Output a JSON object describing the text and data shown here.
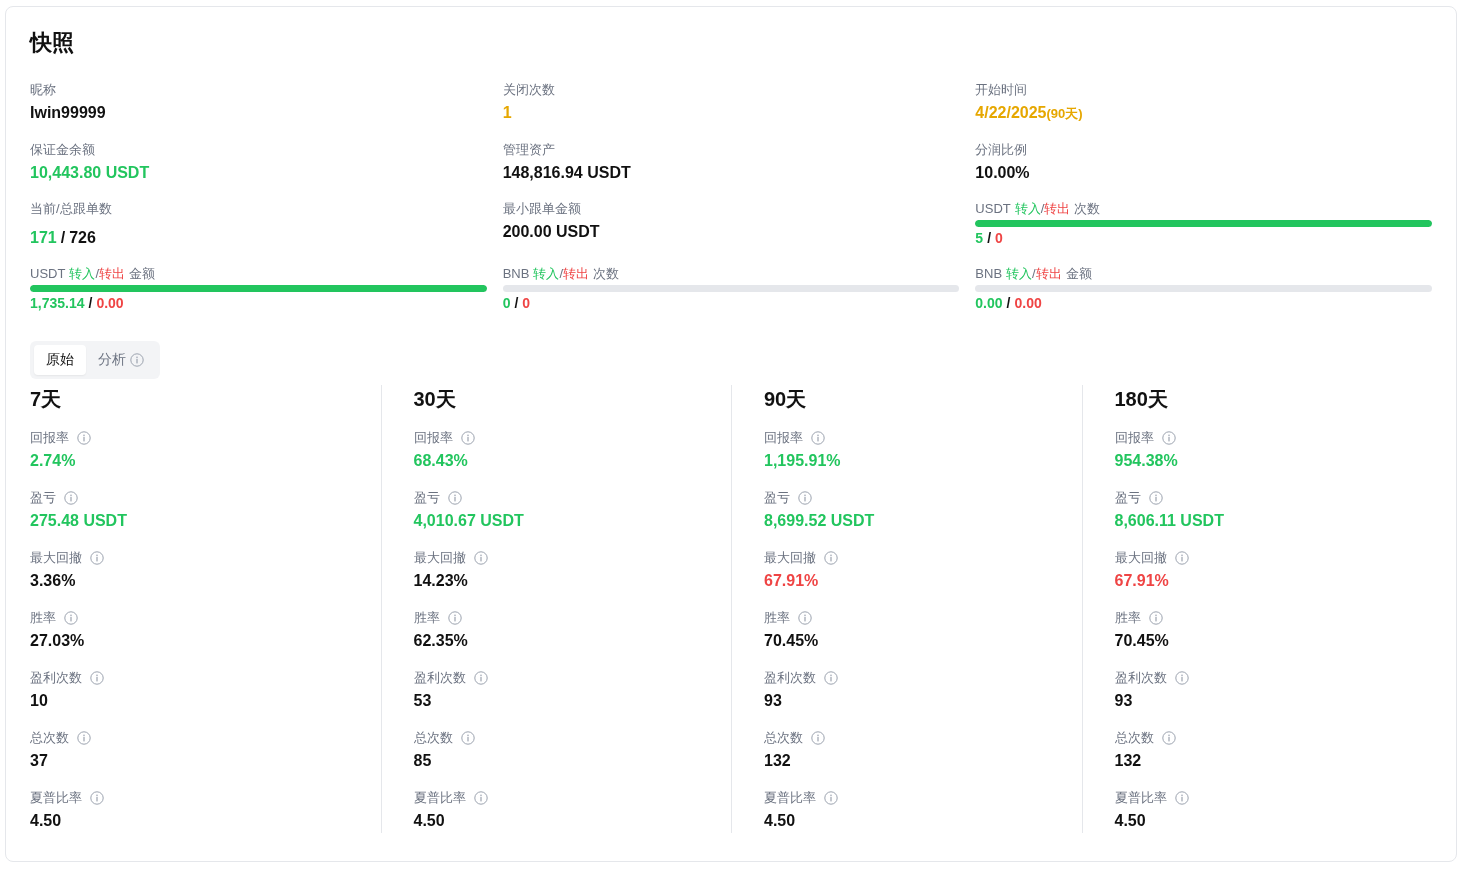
{
  "snapshot": {
    "title": "快照",
    "fields": [
      {
        "kind": "plain",
        "label": "昵称",
        "value": "Iwin99999",
        "color": "#111111"
      },
      {
        "kind": "plain",
        "label": "关闭次数",
        "value": "1",
        "color": "#e6a700"
      },
      {
        "kind": "date",
        "label": "开始时间",
        "value": "4/22/2025",
        "note": "(90天)",
        "color": "#e6a700"
      },
      {
        "kind": "plain",
        "label": "保证金余额",
        "value": "10,443.80 USDT",
        "color": "#22c55e"
      },
      {
        "kind": "plain",
        "label": "管理资产",
        "value": "148,816.94 USDT",
        "color": "#111111"
      },
      {
        "kind": "plain",
        "label": "分润比例",
        "value": "10.00%",
        "color": "#111111"
      },
      {
        "kind": "ratio",
        "label": "当前/总跟单数",
        "first": "171",
        "separator": "/",
        "second": "726"
      },
      {
        "kind": "plain",
        "label": "最小跟单金额",
        "value": "200.00 USDT",
        "color": "#111111"
      },
      {
        "kind": "flow",
        "prefix": "USDT",
        "in_label": "转入",
        "slash": "/",
        "out_label": "转出",
        "suffix": "次数",
        "level": 1,
        "in_value": "5",
        "separator": "/",
        "out_value": "0"
      },
      {
        "kind": "flow",
        "prefix": "USDT",
        "in_label": "转入",
        "slash": "/",
        "out_label": "转出",
        "suffix": "金额",
        "level": 1,
        "in_value": "1,735.14",
        "separator": "/",
        "out_value": "0.00"
      },
      {
        "kind": "flow",
        "prefix": "BNB",
        "in_label": "转入",
        "slash": "/",
        "out_label": "转出",
        "suffix": "次数",
        "level": 0,
        "in_value": "0",
        "separator": "/",
        "out_value": "0"
      },
      {
        "kind": "flow",
        "prefix": "BNB",
        "in_label": "转入",
        "slash": "/",
        "out_label": "转出",
        "suffix": "金额",
        "level": 0,
        "in_value": "0.00",
        "separator": "/",
        "out_value": "0.00"
      }
    ]
  },
  "tabs": [
    {
      "label": "原始",
      "selected": true,
      "info": false
    },
    {
      "label": "分析",
      "selected": false,
      "info": true
    }
  ],
  "periods": [
    {
      "title": "7天",
      "metrics": [
        {
          "label": "回报率",
          "value": "2.74%",
          "color": "#22c55e"
        },
        {
          "label": "盈亏",
          "value": "275.48 USDT",
          "color": "#22c55e"
        },
        {
          "label": "最大回撤",
          "value": "3.36%",
          "color": "#111111"
        },
        {
          "label": "胜率",
          "value": "27.03%",
          "color": "#111111"
        },
        {
          "label": "盈利次数",
          "value": "10",
          "color": "#111111"
        },
        {
          "label": "总次数",
          "value": "37",
          "color": "#111111"
        },
        {
          "label": "夏普比率",
          "value": "4.50",
          "color": "#111111"
        }
      ]
    },
    {
      "title": "30天",
      "metrics": [
        {
          "label": "回报率",
          "value": "68.43%",
          "color": "#22c55e"
        },
        {
          "label": "盈亏",
          "value": "4,010.67 USDT",
          "color": "#22c55e"
        },
        {
          "label": "最大回撤",
          "value": "14.23%",
          "color": "#111111"
        },
        {
          "label": "胜率",
          "value": "62.35%",
          "color": "#111111"
        },
        {
          "label": "盈利次数",
          "value": "53",
          "color": "#111111"
        },
        {
          "label": "总次数",
          "value": "85",
          "color": "#111111"
        },
        {
          "label": "夏普比率",
          "value": "4.50",
          "color": "#111111"
        }
      ]
    },
    {
      "title": "90天",
      "metrics": [
        {
          "label": "回报率",
          "value": "1,195.91%",
          "color": "#22c55e"
        },
        {
          "label": "盈亏",
          "value": "8,699.52 USDT",
          "color": "#22c55e"
        },
        {
          "label": "最大回撤",
          "value": "67.91%",
          "color": "#ef4444"
        },
        {
          "label": "胜率",
          "value": "70.45%",
          "color": "#111111"
        },
        {
          "label": "盈利次数",
          "value": "93",
          "color": "#111111"
        },
        {
          "label": "总次数",
          "value": "132",
          "color": "#111111"
        },
        {
          "label": "夏普比率",
          "value": "4.50",
          "color": "#111111"
        }
      ]
    },
    {
      "title": "180天",
      "metrics": [
        {
          "label": "回报率",
          "value": "954.38%",
          "color": "#22c55e"
        },
        {
          "label": "盈亏",
          "value": "8,606.11 USDT",
          "color": "#22c55e"
        },
        {
          "label": "最大回撤",
          "value": "67.91%",
          "color": "#ef4444"
        },
        {
          "label": "胜率",
          "value": "70.45%",
          "color": "#111111"
        },
        {
          "label": "盈利次数",
          "value": "93",
          "color": "#111111"
        },
        {
          "label": "总次数",
          "value": "132",
          "color": "#111111"
        },
        {
          "label": "夏普比率",
          "value": "4.50",
          "color": "#111111"
        }
      ]
    }
  ]
}
